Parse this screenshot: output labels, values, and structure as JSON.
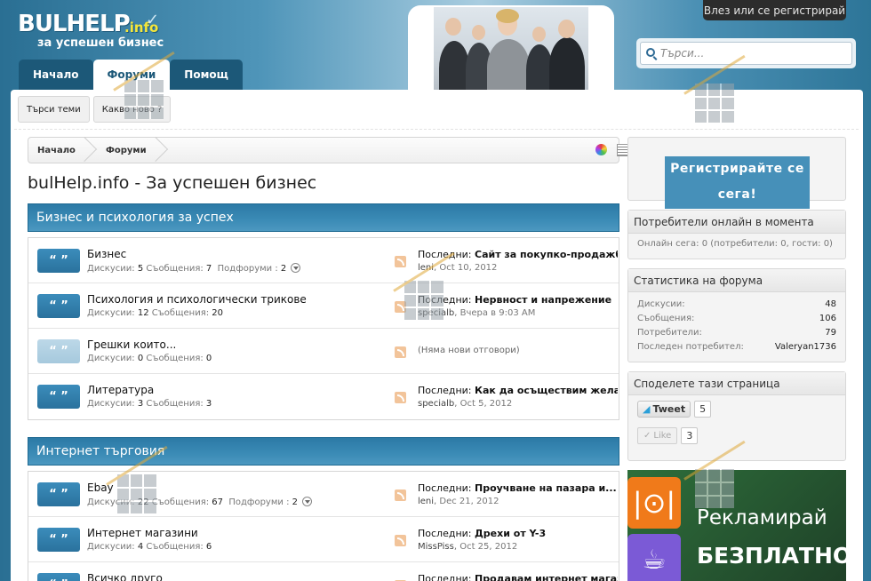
{
  "header": {
    "logo_main": "BULHELP",
    "logo_info": ".info",
    "logo_tagline": "за успешен бизнес",
    "login_label": "Влез или се регистрирай",
    "search_placeholder": "Търси..."
  },
  "nav": {
    "tabs": [
      {
        "label": "Начало"
      },
      {
        "label": "Форуми"
      },
      {
        "label": "Помощ"
      }
    ],
    "subnav": [
      {
        "label": "Търси теми"
      },
      {
        "label": "Какво ново ?"
      }
    ]
  },
  "breadcrumb": [
    {
      "label": "Начало"
    },
    {
      "label": "Форуми"
    }
  ],
  "page_title": "bulHelp.info - За успешен бизнес",
  "categories": [
    {
      "title": "Бизнес и психология за успех",
      "forums": [
        {
          "name": "Бизнес",
          "disc_label": "Дискусии:",
          "disc": "5",
          "msg_label": "Съобщения:",
          "msg": "7",
          "sub_label": "Подфоруми :",
          "sub": "2",
          "lp_label": "Последни:",
          "lp_title": "Сайт за покупко-продажби",
          "lp_user": "leni",
          "lp_date": "Oct 10, 2012"
        },
        {
          "name": "Психология и психологически трикове",
          "disc_label": "Дискусии:",
          "disc": "12",
          "msg_label": "Съобщения:",
          "msg": "20",
          "lp_label": "Последни:",
          "lp_title": "Нервност и напрежение",
          "lp_user": "specialb",
          "lp_date": "Вчера в 9:03 AM"
        },
        {
          "name": "Грешки които...",
          "disc_label": "Дискусии:",
          "disc": "0",
          "msg_label": "Съобщения:",
          "msg": "0",
          "no_replies": "(Няма нови отговори)"
        },
        {
          "name": "Литература",
          "disc_label": "Дискусии:",
          "disc": "3",
          "msg_label": "Съобщения:",
          "msg": "3",
          "lp_label": "Последни:",
          "lp_title": "Как да осъществим желани",
          "lp_user": "specialb",
          "lp_date": "Oct 5, 2012"
        }
      ]
    },
    {
      "title": "Интернет търговия",
      "forums": [
        {
          "name": "Ebay",
          "disc_label": "Дискусии:",
          "disc": "22",
          "msg_label": "Съобщения:",
          "msg": "67",
          "sub_label": "Подфоруми :",
          "sub": "2",
          "lp_label": "Последни:",
          "lp_title": "Проучване на пазара и...",
          "lp_user": "leni",
          "lp_date": "Dec 21, 2012"
        },
        {
          "name": "Интернет магазини",
          "disc_label": "Дискусии:",
          "disc": "4",
          "msg_label": "Съобщения:",
          "msg": "6",
          "lp_label": "Последни:",
          "lp_title": "Дрехи от Y-3",
          "lp_user": "MissPiss",
          "lp_date": "Oct 25, 2012"
        },
        {
          "name": "Всичко друго",
          "lp_label": "Последни:",
          "lp_title": "Продавам интернет магази"
        }
      ]
    }
  ],
  "sidebar": {
    "register_label": "Регистрирайте се сега!",
    "online": {
      "title": "Потребители онлайн в момента",
      "text": "Онлайн сега: 0 (потребители: 0, гости: 0)"
    },
    "stats": {
      "title": "Статистика на форума",
      "rows": [
        {
          "label": "Дискусии:",
          "value": "48"
        },
        {
          "label": "Съобщения:",
          "value": "106"
        },
        {
          "label": "Потребители:",
          "value": "79"
        },
        {
          "label": "Последен потребител:",
          "value": "Valeryan1736"
        }
      ]
    },
    "share": {
      "title": "Споделете тази страница",
      "tweet_label": "Tweet",
      "tweet_count": "5",
      "like_label": "Like",
      "like_count": "3"
    },
    "ad": {
      "line1": "Рекламирай",
      "line2": "БЕЗПЛАТНО"
    }
  },
  "colors": {
    "accent": "#2c7aa6",
    "nav_dark": "#1c5878"
  }
}
